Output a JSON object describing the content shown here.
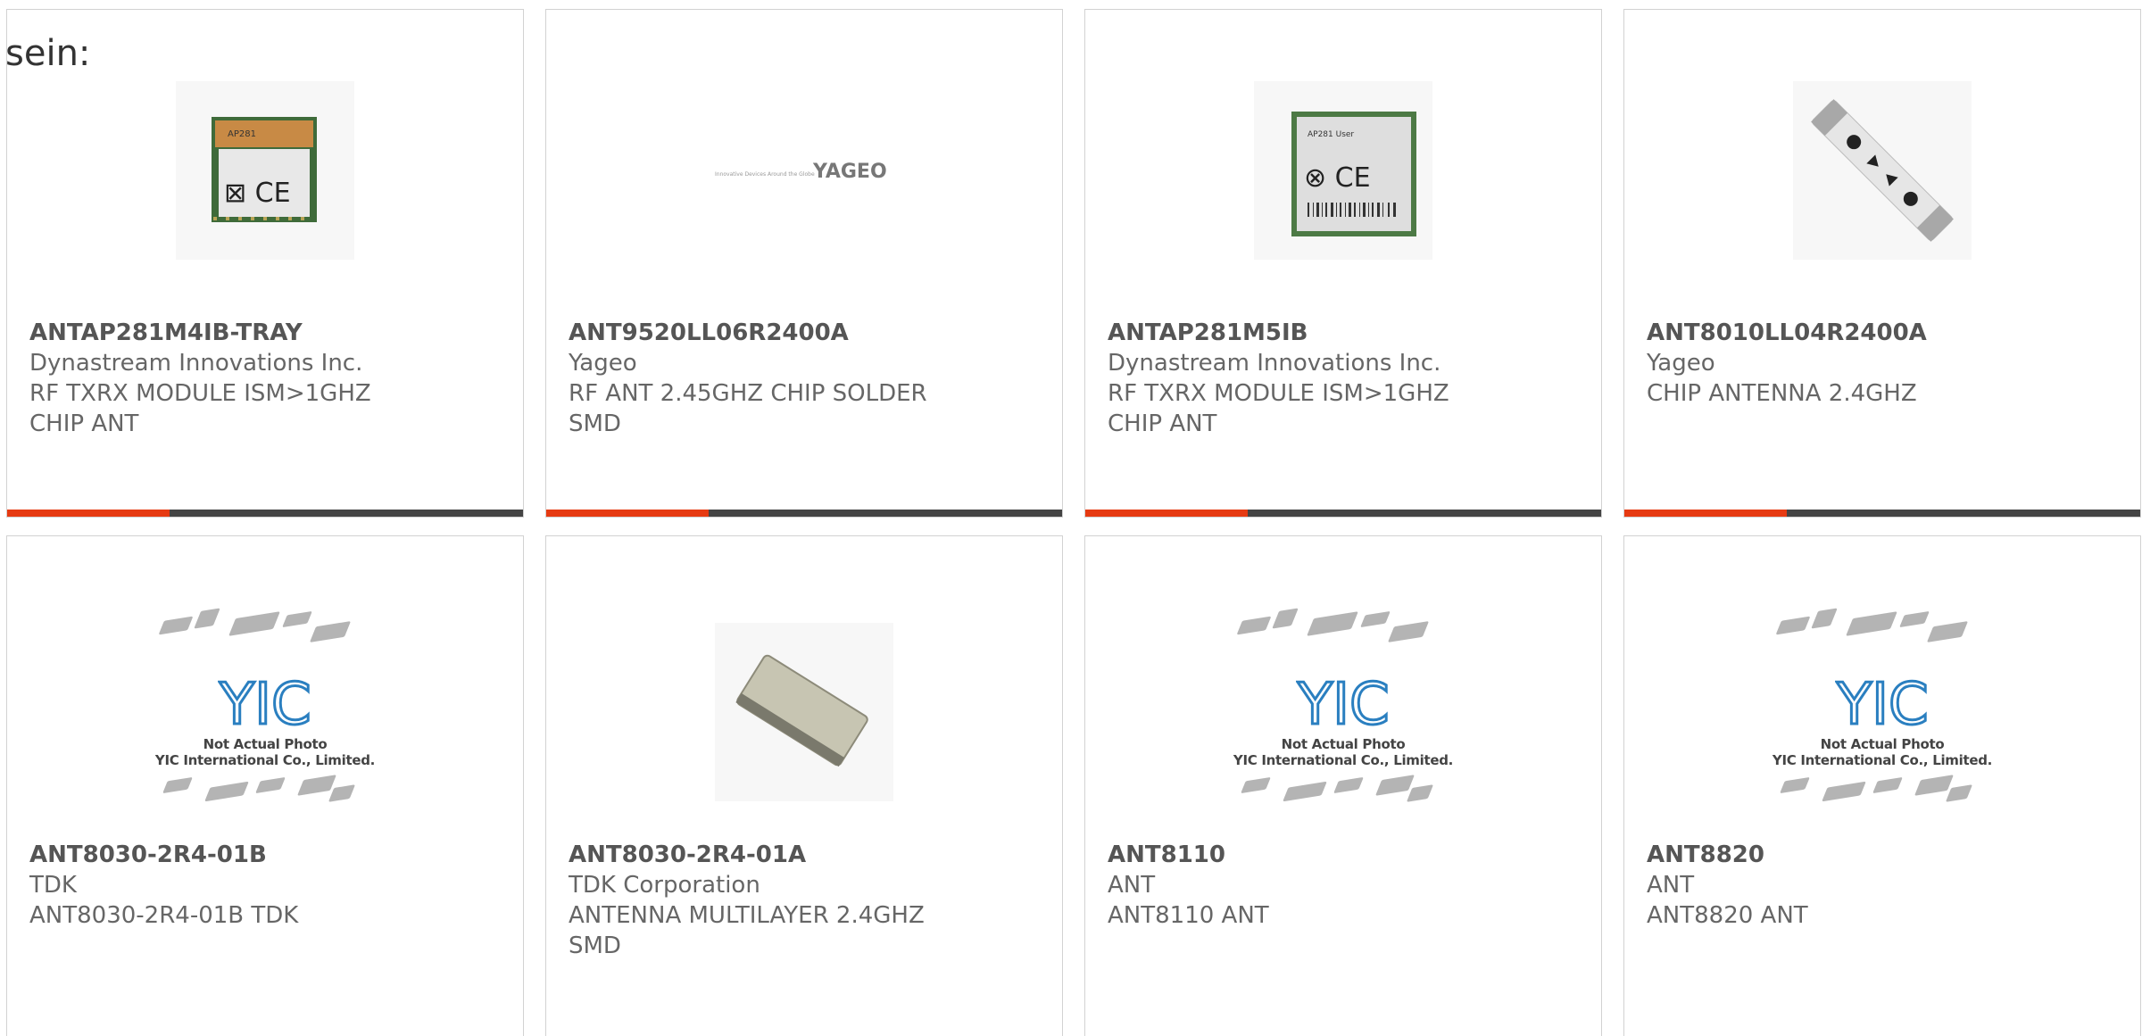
{
  "intro_text": "sein:",
  "products": [
    {
      "part_number": "ANTAP281M4IB-TRAY",
      "manufacturer": "Dynastream Innovations Inc.",
      "description_line1": "RF TXRX MODULE ISM>1GHZ",
      "description_line2": "CHIP ANT",
      "image_type": "rf-module-photo"
    },
    {
      "part_number": "ANT9520LL06R2400A",
      "manufacturer": "Yageo",
      "description_line1": "RF ANT 2.45GHZ CHIP SOLDER",
      "description_line2": "SMD",
      "image_type": "yageo-logo",
      "logo_text": "YAGEO",
      "logo_tagline": "Innovative Devices Around the Globe"
    },
    {
      "part_number": "ANTAP281M5IB",
      "manufacturer": "Dynastream Innovations Inc.",
      "description_line1": "RF TXRX MODULE ISM>1GHZ",
      "description_line2": "CHIP ANT",
      "image_type": "rf-module-photo"
    },
    {
      "part_number": "ANT8010LL04R2400A",
      "manufacturer": "Yageo",
      "description_line1": "CHIP ANTENNA 2.4GHZ",
      "description_line2": "",
      "image_type": "chip-antenna-photo"
    },
    {
      "part_number": "ANT8030-2R4-01B",
      "manufacturer": "TDK",
      "description_line1": "ANT8030-2R4-01B TDK",
      "description_line2": "",
      "image_type": "not-actual-photo"
    },
    {
      "part_number": "ANT8030-2R4-01A",
      "manufacturer": "TDK Corporation",
      "description_line1": "ANTENNA MULTILAYER 2.4GHZ",
      "description_line2": "SMD",
      "image_type": "ceramic-chip-photo"
    },
    {
      "part_number": "ANT8110",
      "manufacturer": "ANT",
      "description_line1": "ANT8110 ANT",
      "description_line2": "",
      "image_type": "not-actual-photo"
    },
    {
      "part_number": "ANT8820",
      "manufacturer": "ANT",
      "description_line1": "ANT8820 ANT",
      "description_line2": "",
      "image_type": "not-actual-photo"
    }
  ],
  "placeholder": {
    "logo_text": "YIC",
    "caption1": "Not Actual Photo",
    "caption2": "YIC International Co., Limited."
  },
  "colors": {
    "accent": "#e63a12",
    "bar": "#444444",
    "border": "#d2d2d2",
    "text": "#666666",
    "logo_blue": "#2a7fc0"
  }
}
